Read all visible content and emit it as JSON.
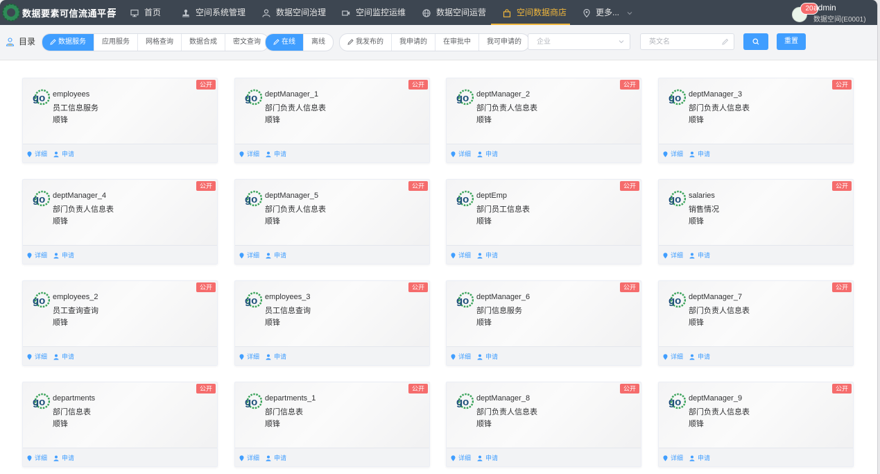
{
  "app": {
    "title": "数据要素可信流通平台",
    "logo_icon": "gear-logo-icon",
    "menu_icon": "hamburger-icon"
  },
  "nav": [
    {
      "label": "首页",
      "icon": "monitor-icon"
    },
    {
      "label": "空间系统管理",
      "icon": "stamp-icon"
    },
    {
      "label": "数据空间治理",
      "icon": "user-icon"
    },
    {
      "label": "空间监控运维",
      "icon": "video-icon"
    },
    {
      "label": "数据空间运营",
      "icon": "globe-icon"
    },
    {
      "label": "空间数据商店",
      "icon": "shopping-bag-icon",
      "active": true
    },
    {
      "label": "更多...",
      "icon": "location-pin-icon"
    }
  ],
  "user": {
    "badge_count": "20",
    "name": "admin",
    "space": "数据空间(E0001)"
  },
  "toolbar": {
    "directory_label": "目录",
    "service_tabs": [
      "数据服务",
      "应用服务",
      "网格查询",
      "数据合成",
      "密文查询"
    ],
    "mode_tabs": [
      "在线",
      "离线"
    ],
    "publish_tabs": [
      "我发布的",
      "我申请的",
      "在审批中",
      "我可申请的"
    ],
    "company_placeholder": "企业",
    "name_placeholder": "英文名",
    "reset_label": "重置"
  },
  "colors": {
    "primary": "#409eff",
    "active_nav": "#f0b63c",
    "tag": "#f56c6c",
    "topbar": "#3d4651"
  },
  "card_labels": {
    "tag": "公开",
    "detail": "详细",
    "apply": "申请"
  },
  "cards": [
    {
      "name": "employees",
      "desc": "员工信息服务",
      "owner": "顺锋"
    },
    {
      "name": "deptManager_1",
      "desc": "部门负责人信息表",
      "owner": "顺锋"
    },
    {
      "name": "deptManager_2",
      "desc": "部门负责人信息表",
      "owner": "顺锋"
    },
    {
      "name": "deptManager_3",
      "desc": "部门负责人信息表",
      "owner": "顺锋"
    },
    {
      "name": "deptManager_4",
      "desc": "部门负责人信息表",
      "owner": "顺锋"
    },
    {
      "name": "deptManager_5",
      "desc": "部门负责人信息表",
      "owner": "顺锋"
    },
    {
      "name": "deptEmp",
      "desc": "部门员工信息表",
      "owner": "顺锋"
    },
    {
      "name": "salaries",
      "desc": "销售情况",
      "owner": "顺锋"
    },
    {
      "name": "employees_2",
      "desc": "员工查询查询",
      "owner": "顺锋"
    },
    {
      "name": "employees_3",
      "desc": "员工信息查询",
      "owner": "顺锋"
    },
    {
      "name": "deptManager_6",
      "desc": "部门信息服务",
      "owner": "顺锋"
    },
    {
      "name": "deptManager_7",
      "desc": "部门负责人信息表",
      "owner": "顺锋"
    },
    {
      "name": "departments",
      "desc": "部门信息表",
      "owner": "顺锋"
    },
    {
      "name": "departments_1",
      "desc": "部门信息表",
      "owner": "顺锋"
    },
    {
      "name": "deptManager_8",
      "desc": "部门负责人信息表",
      "owner": "顺锋"
    },
    {
      "name": "deptManager_9",
      "desc": "部门负责人信息表",
      "owner": "顺锋"
    }
  ]
}
